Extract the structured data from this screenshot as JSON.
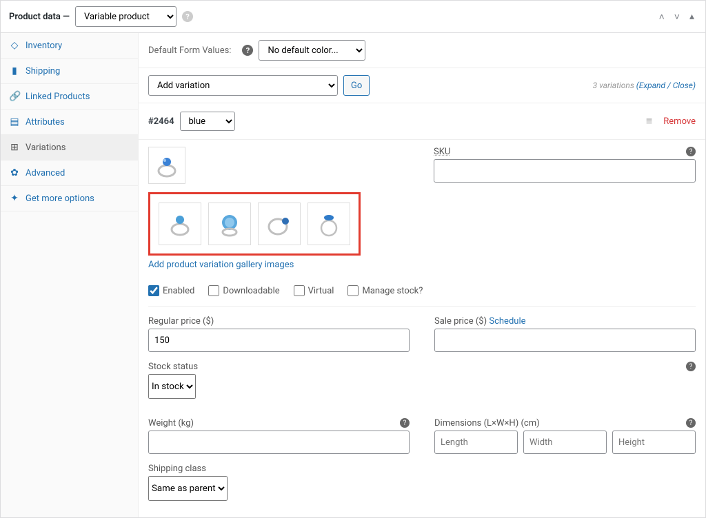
{
  "header": {
    "title": "Product data —",
    "product_type": "Variable product"
  },
  "sidebar": {
    "items": [
      {
        "label": "Inventory",
        "icon": "⬚"
      },
      {
        "label": "Shipping",
        "icon": "🚚"
      },
      {
        "label": "Linked Products",
        "icon": "🔗"
      },
      {
        "label": "Attributes",
        "icon": "▤"
      },
      {
        "label": "Variations",
        "icon": "⊞"
      },
      {
        "label": "Advanced",
        "icon": "⚙"
      },
      {
        "label": "Get more options",
        "icon": "✦"
      }
    ]
  },
  "default_form": {
    "label": "Default Form Values:",
    "selected": "No default color..."
  },
  "actions": {
    "add_variation": "Add variation",
    "go": "Go",
    "count_text": "3 variations",
    "expand_close": "(Expand / Close)"
  },
  "variation": {
    "id": "#2464",
    "color": "blue",
    "remove": "Remove",
    "gallery_link": "Add product variation gallery images",
    "checkboxes": {
      "enabled": "Enabled",
      "downloadable": "Downloadable",
      "virtual": "Virtual",
      "manage_stock": "Manage stock?"
    },
    "fields": {
      "sku_label": "SKU",
      "regular_price_label": "Regular price ($)",
      "regular_price_value": "150",
      "sale_price_label": "Sale price ($) ",
      "schedule_link": "Schedule",
      "stock_status_label": "Stock status",
      "stock_status_value": "In stock",
      "weight_label": "Weight (kg)",
      "dimensions_label": "Dimensions (L×W×H) (cm)",
      "length_ph": "Length",
      "width_ph": "Width",
      "height_ph": "Height",
      "shipping_class_label": "Shipping class",
      "shipping_class_value": "Same as parent"
    }
  }
}
